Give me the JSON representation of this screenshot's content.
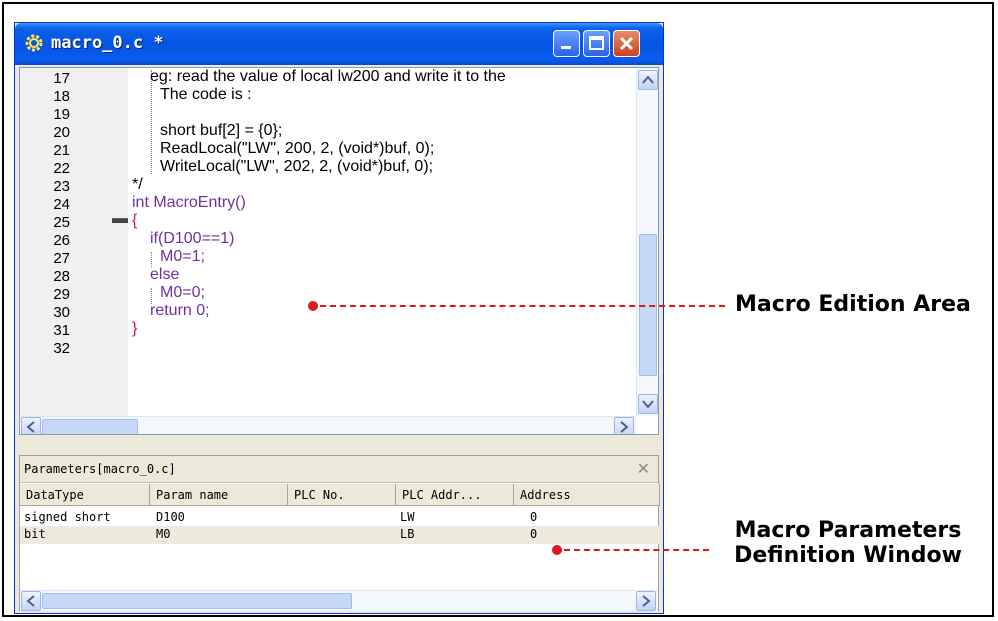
{
  "window": {
    "title": "macro_0.c *"
  },
  "editor": {
    "lines": [
      {
        "n": "17",
        "text": "eg: read the value of local lw200 and write it to the"
      },
      {
        "n": "18",
        "text": "The code is :"
      },
      {
        "n": "19",
        "text": ""
      },
      {
        "n": "20",
        "text": "short buf[2] = {0};"
      },
      {
        "n": "21",
        "text": "ReadLocal(\"LW\", 200, 2, (void*)buf, 0);"
      },
      {
        "n": "22",
        "text": "WriteLocal(\"LW\", 202, 2, (void*)buf, 0);"
      },
      {
        "n": "23",
        "text": "*/"
      },
      {
        "n": "24",
        "text": "int MacroEntry()"
      },
      {
        "n": "25",
        "text": "{"
      },
      {
        "n": "26",
        "text": "if(D100==1)"
      },
      {
        "n": "27",
        "text": "M0=1;"
      },
      {
        "n": "28",
        "text": "else"
      },
      {
        "n": "29",
        "text": "M0=0;"
      },
      {
        "n": "30",
        "text": "return 0;"
      },
      {
        "n": "31",
        "text": "}"
      },
      {
        "n": "32",
        "text": ""
      }
    ]
  },
  "params": {
    "title": "Parameters[macro_0.c]",
    "columns": [
      "DataType",
      "Param name",
      "PLC No.",
      "PLC Addr...",
      "Address"
    ],
    "rows": [
      [
        "signed short",
        "D100",
        "",
        "LW",
        "0"
      ],
      [
        "bit",
        "M0",
        "",
        "LB",
        "0"
      ]
    ]
  },
  "annotations": {
    "edit_area": "Macro Edition Area",
    "params_line1": "Macro Parameters",
    "params_line2": "Definition Window"
  },
  "colors": {
    "accent": "#e01818",
    "titlebar": "#0553e0",
    "keyword": "#7030a0",
    "operator": "#d0143a"
  },
  "icons": [
    "gear-icon",
    "minimize-icon",
    "maximize-icon",
    "close-icon",
    "scroll-up-icon",
    "scroll-down-icon",
    "scroll-left-icon",
    "scroll-right-icon"
  ]
}
